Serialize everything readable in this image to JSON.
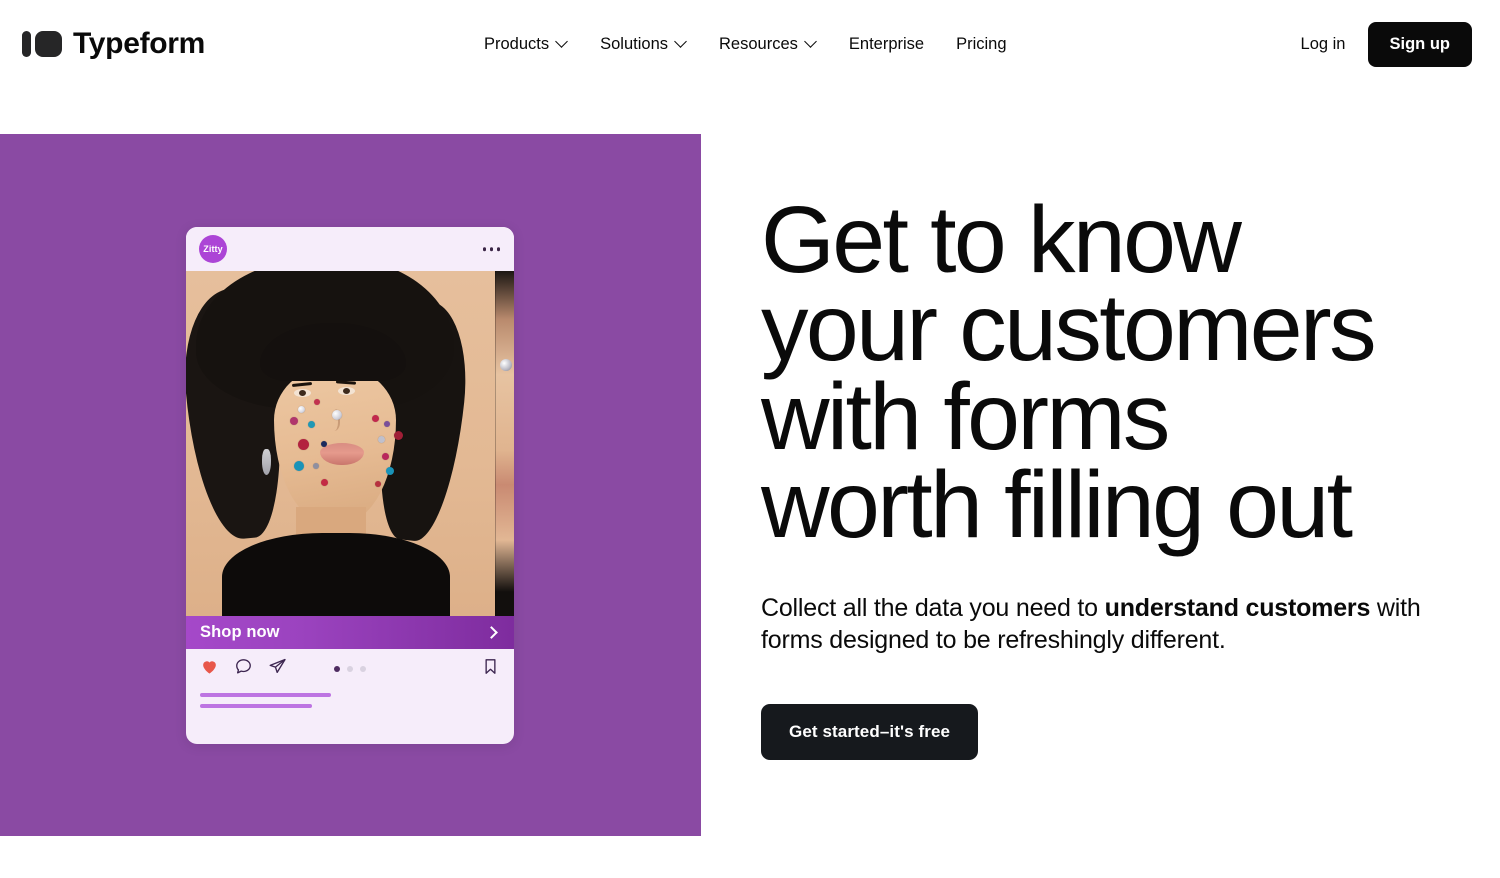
{
  "brand": {
    "name": "Typeform",
    "logo_icon": "typeform-logo-icon"
  },
  "nav": {
    "items": [
      {
        "label": "Products",
        "has_dropdown": true
      },
      {
        "label": "Solutions",
        "has_dropdown": true
      },
      {
        "label": "Resources",
        "has_dropdown": true
      },
      {
        "label": "Enterprise",
        "has_dropdown": false
      },
      {
        "label": "Pricing",
        "has_dropdown": false
      }
    ],
    "login_label": "Log in",
    "signup_label": "Sign up"
  },
  "hero": {
    "title": "Get to know\nyour customers\nwith forms\nworth filling out",
    "sub_before": "Collect all the data you need to ",
    "sub_bold": "understand customers",
    "sub_after": " with forms designed to be refreshingly different.",
    "cta_label": "Get started–it's free",
    "background_color": "#8a4aa3"
  },
  "post_card": {
    "account_name": "Zitty",
    "menu_icon": "more-options-icon",
    "shop_label": "Shop now",
    "shop_arrow_icon": "chevron-right-icon",
    "like_icon": "heart-icon",
    "comment_icon": "comment-icon",
    "share_icon": "share-icon",
    "bookmark_icon": "bookmark-icon",
    "pagination": {
      "total": 3,
      "active": 1
    },
    "card_background": "#f6edfa",
    "avatar_color": "#ac45d6",
    "heart_color": "#e8574a",
    "shop_bar_gradient_from": "#a548c9",
    "shop_bar_gradient_to": "#7e2c9e"
  }
}
